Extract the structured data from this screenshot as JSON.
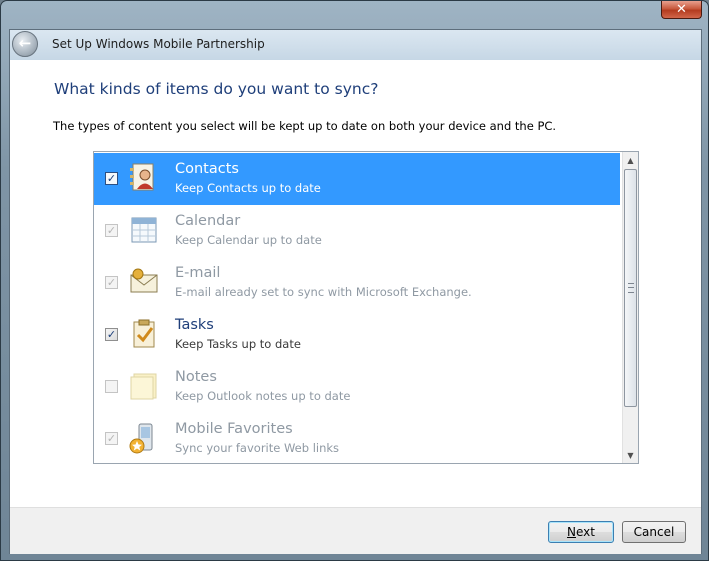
{
  "window": {
    "title": "Set Up Windows Mobile Partnership",
    "close_glyph": "✕",
    "back_glyph": "←"
  },
  "main": {
    "heading": "What kinds of items do you want to sync?",
    "description": "The types of content you select will be kept up to date on both your device and the PC."
  },
  "sync_items": [
    {
      "name": "Contacts",
      "subtitle": "Keep Contacts up to date",
      "checked": true,
      "enabled": true,
      "selected": true,
      "icon": "contacts-icon"
    },
    {
      "name": "Calendar",
      "subtitle": "Keep Calendar up to date",
      "checked": true,
      "enabled": false,
      "selected": false,
      "icon": "calendar-icon"
    },
    {
      "name": "E-mail",
      "subtitle": "E-mail already set to sync with Microsoft Exchange.",
      "checked": true,
      "enabled": false,
      "selected": false,
      "icon": "email-icon"
    },
    {
      "name": "Tasks",
      "subtitle": "Keep Tasks up to date",
      "checked": true,
      "enabled": true,
      "selected": false,
      "icon": "tasks-icon"
    },
    {
      "name": "Notes",
      "subtitle": "Keep Outlook notes up to date",
      "checked": false,
      "enabled": false,
      "selected": false,
      "icon": "notes-icon"
    },
    {
      "name": "Mobile Favorites",
      "subtitle": "Sync your favorite Web links",
      "checked": true,
      "enabled": false,
      "selected": false,
      "icon": "favorites-icon"
    }
  ],
  "scrollbar": {
    "up_glyph": "▲",
    "down_glyph": "▼"
  },
  "footer": {
    "next_label": "Next",
    "cancel_label": "Cancel"
  },
  "colors": {
    "selection": "#3399ff",
    "heading": "#1f3f7a"
  }
}
